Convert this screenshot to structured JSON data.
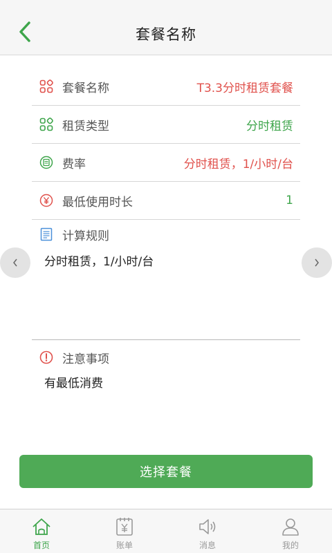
{
  "header": {
    "title": "套餐名称"
  },
  "rows": [
    {
      "label": "套餐名称",
      "value": "T3.3分时租赁套餐",
      "value_color": "#e0514c",
      "icon": "grid-red-icon"
    },
    {
      "label": "租赁类型",
      "value": "分时租赁",
      "value_color": "#3ea54b",
      "icon": "grid-green-icon"
    },
    {
      "label": "费率",
      "value": "分时租赁，1/小时/台",
      "value_color": "#e0514c",
      "icon": "rate-icon"
    },
    {
      "label": "最低使用时长",
      "value": "1",
      "value_color": "#3ea54b",
      "icon": "yen-icon"
    }
  ],
  "rules": {
    "title": "计算规则",
    "text": "分时租赁，1/小时/台"
  },
  "notice": {
    "title": "注意事项",
    "text": "有最低消费"
  },
  "select_button": "选择套餐",
  "tabs": [
    {
      "label": "首页",
      "icon": "home-icon",
      "active": true
    },
    {
      "label": "账单",
      "icon": "bill-icon",
      "active": false
    },
    {
      "label": "消息",
      "icon": "speaker-icon",
      "active": false
    },
    {
      "label": "我的",
      "icon": "user-icon",
      "active": false
    }
  ],
  "colors": {
    "accent_green": "#4faa56",
    "value_red": "#e0514c",
    "value_green": "#3ea54b"
  }
}
